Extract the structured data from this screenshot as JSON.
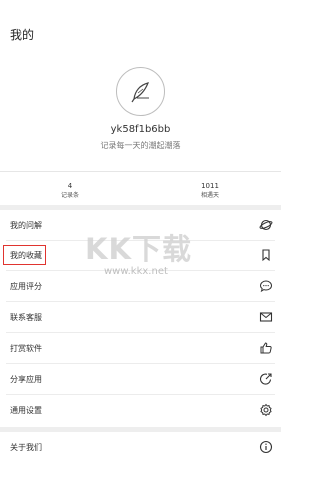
{
  "header": {
    "title": "我的"
  },
  "profile": {
    "avatar_icon": "feather-icon",
    "username": "yk58f1b6bb",
    "signature": "记录每一天的潮起潮落"
  },
  "stats": [
    {
      "value": "4",
      "label": "记录条"
    },
    {
      "value": "1011",
      "label": "相遇天"
    }
  ],
  "menu": [
    {
      "label": "我的问解",
      "icon": "planet-icon"
    },
    {
      "label": "我的收藏",
      "icon": "bookmark-icon"
    },
    {
      "label": "应用评分",
      "icon": "comment-icon"
    },
    {
      "label": "联系客服",
      "icon": "mail-icon"
    },
    {
      "label": "打赏软件",
      "icon": "thumbs-up-icon"
    },
    {
      "label": "分享应用",
      "icon": "share-icon"
    },
    {
      "label": "通用设置",
      "icon": "settings-icon"
    },
    {
      "label": "关于我们",
      "icon": "info-icon"
    }
  ],
  "watermark": {
    "text": "KK下载",
    "url": "www.kkx.net"
  },
  "colors": {
    "highlight": "#e0342f",
    "background": "#ffffff",
    "band": "#eeeeee"
  }
}
